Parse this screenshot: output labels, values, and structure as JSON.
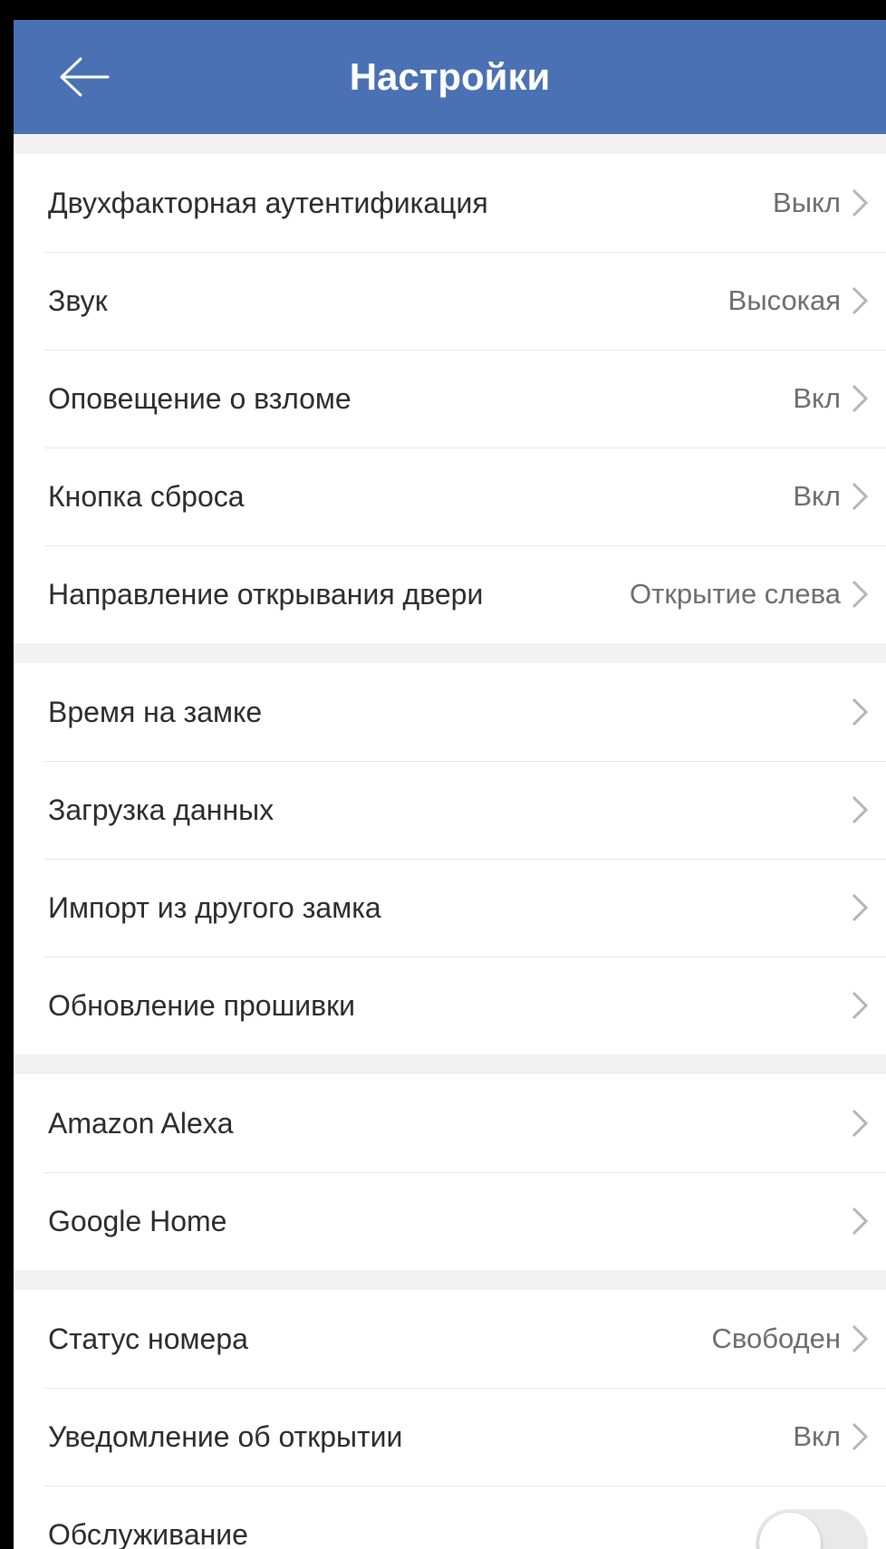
{
  "header": {
    "title": "Настройки",
    "back_icon": "arrow-left-icon",
    "background": "#4a71b4"
  },
  "groups": [
    {
      "rows": [
        {
          "label": "Двухфакторная аутентификация",
          "value": "Выкл"
        },
        {
          "label": "Звук",
          "value": "Высокая"
        },
        {
          "label": "Оповещение о взломе",
          "value": "Вкл"
        },
        {
          "label": "Кнопка сброса",
          "value": "Вкл"
        },
        {
          "label": "Направление открывания двери",
          "value": "Открытие слева"
        }
      ]
    },
    {
      "rows": [
        {
          "label": "Время на замке",
          "value": ""
        },
        {
          "label": "Загрузка данных",
          "value": ""
        },
        {
          "label": "Импорт из другого замка",
          "value": ""
        },
        {
          "label": "Обновление прошивки",
          "value": ""
        }
      ]
    },
    {
      "rows": [
        {
          "label": "Amazon Alexa",
          "value": ""
        },
        {
          "label": "Google Home",
          "value": ""
        }
      ]
    },
    {
      "rows": [
        {
          "label": "Статус номера",
          "value": "Свободен"
        },
        {
          "label": "Уведомление об открытии",
          "value": "Вкл"
        },
        {
          "label": "Обслуживание",
          "value": "",
          "toggle": true,
          "toggle_on": false
        }
      ]
    }
  ],
  "icons": {
    "chevron": "chevron-right-icon"
  }
}
